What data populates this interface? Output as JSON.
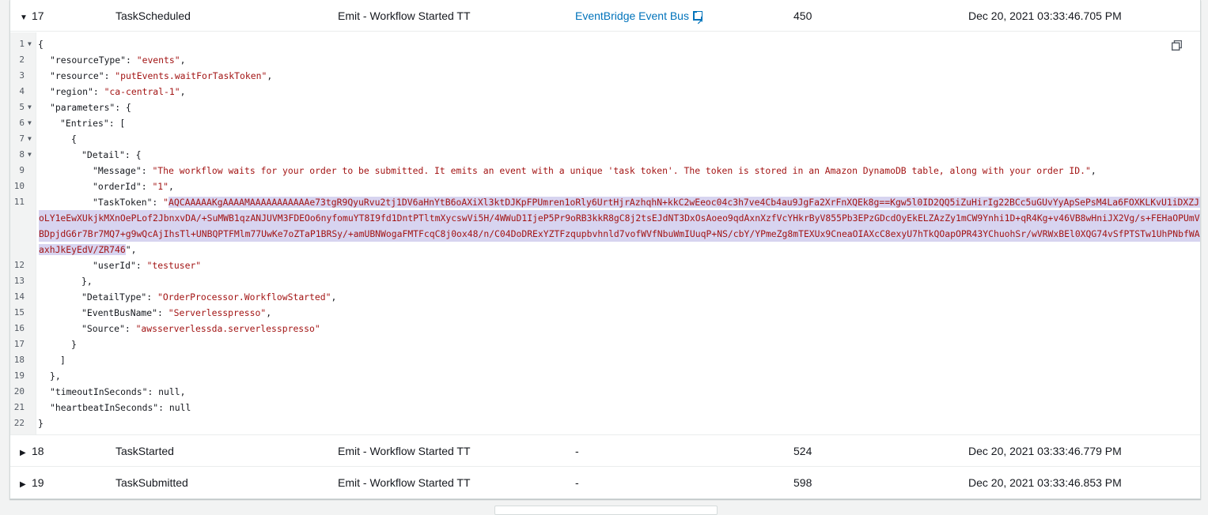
{
  "rows": [
    {
      "id": "17",
      "type": "TaskScheduled",
      "state": "Emit - Workflow Started TT",
      "resource": "EventBridge Event Bus",
      "elapsed": "450",
      "timestamp": "Dec 20, 2021 03:33:46.705 PM",
      "expanded": true
    },
    {
      "id": "18",
      "type": "TaskStarted",
      "state": "Emit - Workflow Started TT",
      "resource": "-",
      "elapsed": "524",
      "timestamp": "Dec 20, 2021 03:33:46.779 PM",
      "expanded": false
    },
    {
      "id": "19",
      "type": "TaskSubmitted",
      "state": "Emit - Workflow Started TT",
      "resource": "-",
      "elapsed": "598",
      "timestamp": "Dec 20, 2021 03:33:46.853 PM",
      "expanded": false
    }
  ],
  "code": {
    "line_numbers": [
      "1",
      "2",
      "3",
      "4",
      "5",
      "6",
      "7",
      "8",
      "9",
      "10",
      "11",
      "12",
      "13",
      "14",
      "15",
      "16",
      "17",
      "18",
      "19",
      "20",
      "21",
      "22"
    ],
    "l1": "{",
    "l2k": "\"resourceType\": ",
    "l2v": "\"events\"",
    "l2e": ",",
    "l3k": "\"resource\": ",
    "l3v": "\"putEvents.waitForTaskToken\"",
    "l3e": ",",
    "l4k": "\"region\": ",
    "l4v": "\"ca-central-1\"",
    "l4e": ",",
    "l5k": "\"parameters\": {",
    "l6k": "\"Entries\": [",
    "l7": "{",
    "l8k": "\"Detail\": {",
    "l9k": "\"Message\": ",
    "l9v": "\"The workflow waits for your order to be submitted. It emits an event with a unique 'task token'. The token is stored in an Amazon DynamoDB table, along with your order ID.\"",
    "l9e": ",",
    "l10k": "\"orderId\": ",
    "l10v": "\"1\"",
    "l10e": ",",
    "l11k": "\"TaskToken\": ",
    "l11q": "\"",
    "l11a": "AQCAAAAAKgAAAAMAAAAAAAAAAAe73tgR9QyuRvu2tj1DV6aHnYtB6oAXiXl3ktDJKpFPUmren1oRly6UrtHjrAzhqhN+kkC2wEeoc04c3h7ve4Cb4au9JgFa2XrFnXQEk8g==Kgw5l0ID2QQ5iZuHirIg22BCc5uGUvYyApSePsM4La6FOXKLKvU1iDXZJIMbBkHInVe",
    "l11b": "oLY1eEwXUkjkMXnOePLof2JbnxvDA/+SuMWB1qzANJUVM3FDEOo6nyfomuYT8I9fd1DntPTltmXycswVi5H/4WWuD1IjeP5Pr9oRB3kkR8gC8j2tsEJdNT3DxOsAoeo9qdAxnXzfVcYHkrByV855Pb3EPzGDcdOyEkELZAzZy1mCW9Ynhi1D+qR4Kg+v46VB8wHniJX2Vg/s+FEHaOPUmVu/iwbyX4+",
    "l11c": "BDpjdG6r7Br7MQ7+g9wQcAjIhsTl+UNBQPTFMlm77UwKe7oZTaP1BRSy/+amUBNWogaFMTFcqC8j0ox48/n/C04DoDRExYZTFzqupbvhnld7vofWVfNbuWmIUuqP+NS/cbY/YPmeZg8mTEXUx9CneaOIAXcC8exyU7hTkQOapOPR43YChuohSr/wVRWxBEl0XQG74vSfPTSTw1UhPNbfWA1os6zbQzT",
    "l11d": "axhJkEyEdV/ZR746",
    "l11e": "\",",
    "l12k": "\"userId\": ",
    "l12v": "\"testuser\"",
    "l13": "},",
    "l14k": "\"DetailType\": ",
    "l14v": "\"OrderProcessor.WorkflowStarted\"",
    "l14e": ",",
    "l15k": "\"EventBusName\": ",
    "l15v": "\"Serverlesspresso\"",
    "l15e": ",",
    "l16k": "\"Source\": ",
    "l16v": "\"awsserverlessda.serverlesspresso\"",
    "l17": "}",
    "l18": "]",
    "l19": "},",
    "l20k": "\"timeoutInSeconds\": ",
    "l20v": "null",
    "l20e": ",",
    "l21k": "\"heartbeatInSeconds\": ",
    "l21v": "null",
    "l22": "}"
  },
  "icons": {
    "expanded_caret": "caret-down-icon",
    "collapsed_caret": "caret-right-icon",
    "external_link": "external-link-icon",
    "copy": "copy-icon"
  },
  "colors": {
    "link": "#0073bb",
    "string": "#a31515",
    "selection": "#d7d4f0"
  }
}
